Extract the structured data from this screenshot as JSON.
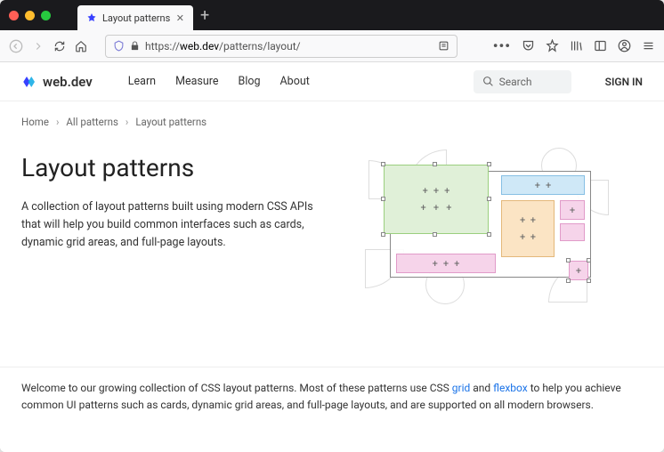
{
  "browser": {
    "tab_title": "Layout patterns",
    "url_display": "https://web.dev/patterns/layout/",
    "url_host": "web.dev",
    "url_path": "/patterns/layout/"
  },
  "site": {
    "logo_text": "web.dev",
    "nav": {
      "learn": "Learn",
      "measure": "Measure",
      "blog": "Blog",
      "about": "About"
    },
    "search_placeholder": "Search",
    "signin": "SIGN IN"
  },
  "breadcrumb": {
    "home": "Home",
    "all": "All patterns",
    "current": "Layout patterns"
  },
  "hero": {
    "title": "Layout patterns",
    "description": "A collection of layout patterns built using modern CSS APIs that will help you build common interfaces such as cards, dynamic grid areas, and full-page layouts."
  },
  "intro": {
    "text_part1": "Welcome to our growing collection of CSS layout patterns. Most of these patterns use CSS ",
    "link1": "grid",
    "text_part2": " and ",
    "link2": "flexbox",
    "text_part3": " to help you achieve common UI patterns such as cards, dynamic grid areas, and full-page layouts, and are supported on all modern browsers."
  }
}
